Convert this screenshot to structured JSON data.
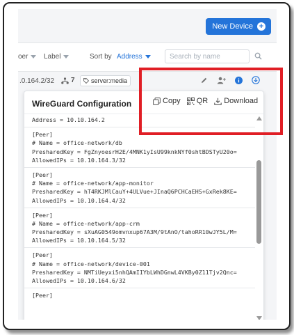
{
  "toolbar": {
    "new_device_label": "New Device"
  },
  "filters": {
    "partial_filter_label": "oer",
    "label_filter": "Label",
    "sort_by_label": "Sort by",
    "sort_value": "Address",
    "search_placeholder": "Search by name"
  },
  "device": {
    "ip_partial": ".0.164.2/32",
    "peers_count": "7",
    "tag": "server:media"
  },
  "panel": {
    "title": "WireGuard Configuration",
    "copy_label": "Copy",
    "qr_label": "QR",
    "download_label": "Download"
  },
  "config": {
    "address_line": "Address = 10.10.164.2",
    "peers": [
      {
        "header": "[Peer]",
        "name": "# Name = office-network/db",
        "psk": "PresharedKey = FgZnyoesrH2E/4MNK1yIsU99knkNYf0shtBDSTyU20o=",
        "ips": "AllowedIPs = 10.10.164.3/32"
      },
      {
        "header": "[Peer]",
        "name": "# Name = office-network/app-monitor",
        "psk": "PresharedKey = hT4RKJMlCauY+4ULVue+JInaQ6PCHCaEHS+GxRek8KE=",
        "ips": "AllowedIPs = 10.10.164.4/32"
      },
      {
        "header": "[Peer]",
        "name": "# Name = office-network/app-crm",
        "psk": "PresharedKey = sXuAG0549omvnxup67A3M/9tAnO/tahoRR10wJY5L/M=",
        "ips": "AllowedIPs = 10.10.164.5/32"
      },
      {
        "header": "[Peer]",
        "name": "# Name = office-network/device-001",
        "psk": "PresharedKey = NMTiUeyxi5nhQAmIIYbLWhDGnwL4VKBy0Z11Tjv2Qnc=",
        "ips": "AllowedIPs = 10.10.164.6/32"
      }
    ],
    "last_header": "[Peer]"
  },
  "colors": {
    "accent": "#2474d9",
    "highlight": "#e01e25"
  },
  "icons": [
    "plus-icon",
    "caret-icon",
    "search-icon",
    "peers-icon",
    "tag-icon",
    "edit-icon",
    "add-user-icon",
    "info-icon",
    "download-icon",
    "copy-icon",
    "qr-icon"
  ]
}
